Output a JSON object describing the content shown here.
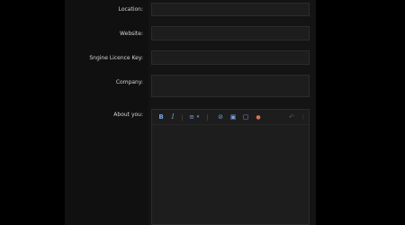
{
  "form": {
    "fields": [
      {
        "label": "Location:"
      },
      {
        "label": "Website:"
      },
      {
        "label": "Sngine Licence Key:"
      },
      {
        "label": "Company:"
      },
      {
        "label": "About you:"
      }
    ]
  },
  "editor": {
    "toolbar": [
      {
        "icon": "bold-icon",
        "glyph": "B"
      },
      {
        "icon": "italic-icon",
        "glyph": "I"
      },
      {
        "icon": "list-icon",
        "glyph": "≡"
      },
      {
        "icon": "chevron-down-icon",
        "glyph": "▾"
      },
      {
        "icon": "link-icon",
        "glyph": "⊘"
      },
      {
        "icon": "image-icon",
        "glyph": "▣"
      },
      {
        "icon": "media-icon",
        "glyph": "▢"
      },
      {
        "icon": "emoji-icon",
        "glyph": "●"
      },
      {
        "icon": "undo-icon",
        "glyph": "↶"
      },
      {
        "icon": "more-icon",
        "glyph": "⋮"
      }
    ]
  },
  "colors": {
    "accent": "#79a3dd",
    "emoji": "#e07050"
  }
}
